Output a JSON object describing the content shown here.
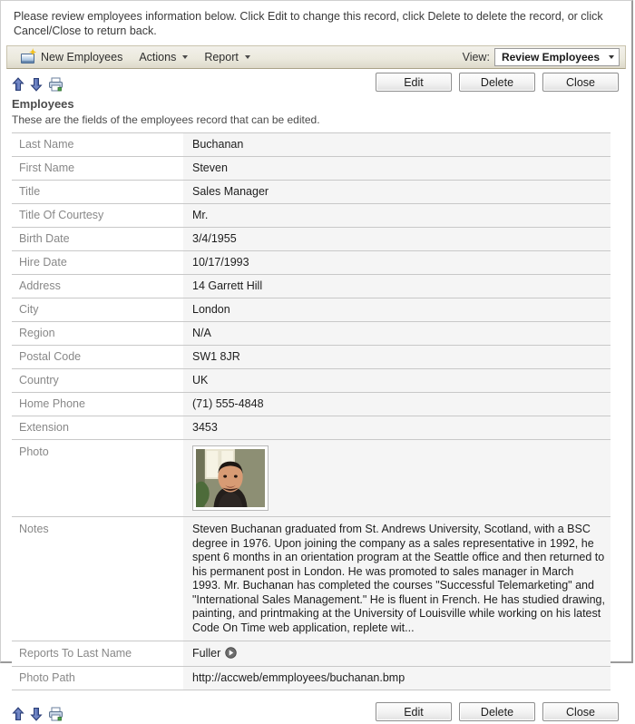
{
  "instructions": "Please review employees information below. Click Edit to change this record, click Delete to delete the record, or click Cancel/Close to return back.",
  "action_bar": {
    "new_label": "New Employees",
    "new_icon": "new-record-icon",
    "actions_label": "Actions",
    "report_label": "Report",
    "view_label": "View:",
    "view_value": "Review Employees",
    "view_options": [
      "Review Employees"
    ]
  },
  "nav": {
    "prev_icon": "arrow-up-icon",
    "next_icon": "arrow-down-icon",
    "print_icon": "printer-icon"
  },
  "buttons": {
    "edit": "Edit",
    "delete": "Delete",
    "close": "Close"
  },
  "section": {
    "title": "Employees",
    "subtitle": "These are the fields of the employees record that can be edited."
  },
  "fields": [
    {
      "label": "Last Name",
      "value": "Buchanan"
    },
    {
      "label": "First Name",
      "value": "Steven"
    },
    {
      "label": "Title",
      "value": "Sales Manager"
    },
    {
      "label": "Title Of Courtesy",
      "value": "Mr."
    },
    {
      "label": "Birth Date",
      "value": "3/4/1955"
    },
    {
      "label": "Hire Date",
      "value": "10/17/1993"
    },
    {
      "label": "Address",
      "value": "14 Garrett Hill"
    },
    {
      "label": "City",
      "value": "London"
    },
    {
      "label": "Region",
      "value": "N/A"
    },
    {
      "label": "Postal Code",
      "value": "SW1 8JR"
    },
    {
      "label": "Country",
      "value": "UK"
    },
    {
      "label": "Home Phone",
      "value": "(71) 555-4848"
    },
    {
      "label": "Extension",
      "value": "3453"
    },
    {
      "label": "Photo",
      "value": ""
    },
    {
      "label": "Notes",
      "value": "Steven Buchanan graduated from St. Andrews University, Scotland, with a BSC degree in 1976. Upon joining the company as a sales representative in 1992, he spent 6 months in an orientation program at the Seattle office and then returned to his permanent post in London. He was promoted to sales manager in March 1993. Mr. Buchanan has completed the courses \"Successful Telemarketing\" and \"International Sales Management.\" He is fluent in French. He has studied drawing, painting, and printmaking at the University of Louisville while working on his latest Code On Time web application, replete wit..."
    },
    {
      "label": "Reports To Last Name",
      "value": "Fuller"
    },
    {
      "label": "Photo Path",
      "value": "http://accweb/emmployees/buchanan.bmp"
    }
  ],
  "photo": {
    "alt": "employee-photo",
    "icon": "employee-portrait"
  },
  "reports_to_lookup_icon": "lookup-arrow-icon",
  "colors": {
    "toolbar_top": "#f2f0ea",
    "toolbar_bottom": "#ddd9ca",
    "label_text": "#888888",
    "value_bg": "#f5f5f5",
    "row_border": "#c8c8c8"
  }
}
